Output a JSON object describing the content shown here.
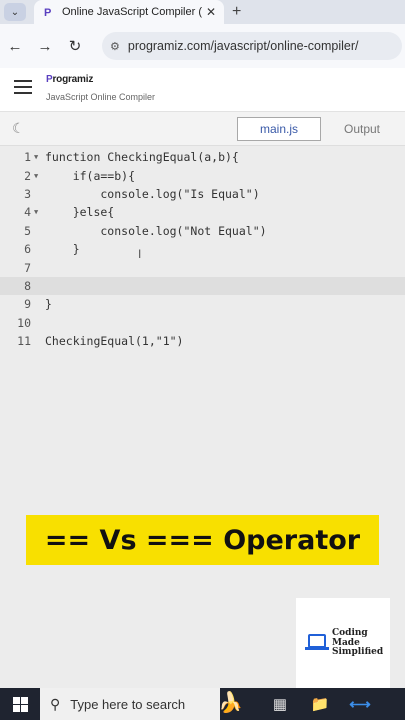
{
  "browser": {
    "tab_title": "Online JavaScript Compiler (Ed",
    "tab_favicon": "P",
    "url": "programiz.com/javascript/online-compiler/"
  },
  "site": {
    "brand_prefix": "P",
    "brand_name": "rogramiz",
    "subtitle": "JavaScript Online Compiler"
  },
  "toolbar": {
    "tab_main": "main.js",
    "tab_output": "Output"
  },
  "editor": {
    "lines": [
      {
        "n": "1",
        "fold": true,
        "text": "function CheckingEqual(a,b){"
      },
      {
        "n": "2",
        "fold": true,
        "text": "    if(a==b){"
      },
      {
        "n": "3",
        "fold": false,
        "text": "        console.log(\"Is Equal\")"
      },
      {
        "n": "4",
        "fold": true,
        "text": "    }else{"
      },
      {
        "n": "5",
        "fold": false,
        "text": "        console.log(\"Not Equal\")"
      },
      {
        "n": "6",
        "fold": false,
        "text": "    }"
      },
      {
        "n": "7",
        "fold": false,
        "text": ""
      },
      {
        "n": "8",
        "fold": false,
        "text": ""
      },
      {
        "n": "9",
        "fold": false,
        "text": "}"
      },
      {
        "n": "10",
        "fold": false,
        "text": ""
      },
      {
        "n": "11",
        "fold": false,
        "text": "CheckingEqual(1,\"1\")"
      }
    ],
    "active_line": 8
  },
  "overlay": {
    "banner": "== Vs === Operator",
    "logo_line1": "Coding",
    "logo_line2": "Made",
    "logo_line3": "Simplified"
  },
  "taskbar": {
    "search_placeholder": "Type here to search"
  }
}
